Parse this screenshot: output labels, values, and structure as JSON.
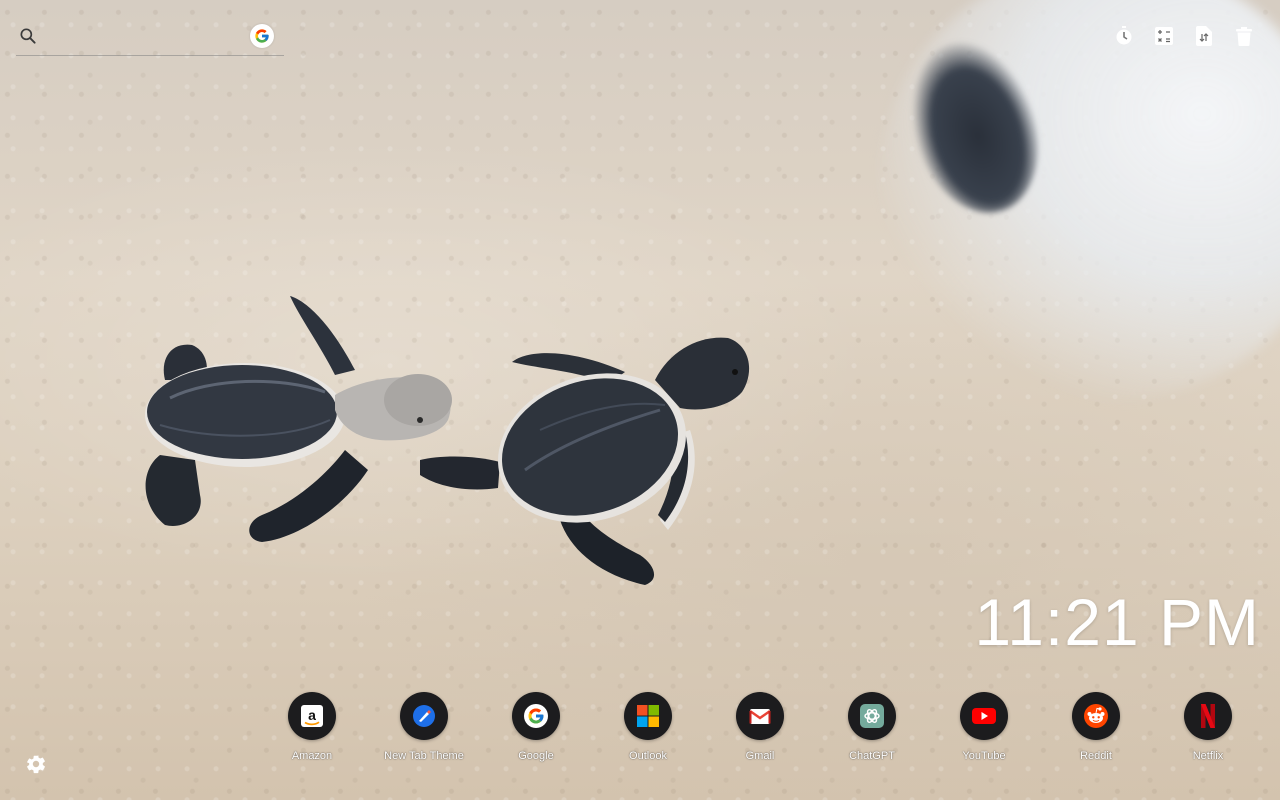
{
  "search": {
    "placeholder": "",
    "value": "",
    "icon": "search-icon",
    "engine_icon": "google-icon"
  },
  "toolbar": {
    "items": [
      {
        "icon": "timer-icon"
      },
      {
        "icon": "calculator-icon"
      },
      {
        "icon": "file-transfer-icon"
      },
      {
        "icon": "trash-icon"
      }
    ]
  },
  "clock": {
    "time": "11:21 PM",
    "color": "#ffffff"
  },
  "shortcuts": [
    {
      "label": "Amazon",
      "icon": "amazon-icon"
    },
    {
      "label": "New Tab Theme",
      "icon": "new-tab-theme-icon"
    },
    {
      "label": "Google",
      "icon": "google-icon"
    },
    {
      "label": "Outlook",
      "icon": "microsoft-icon"
    },
    {
      "label": "Gmail",
      "icon": "gmail-icon"
    },
    {
      "label": "ChatGPT",
      "icon": "chatgpt-icon"
    },
    {
      "label": "YouTube",
      "icon": "youtube-icon"
    },
    {
      "label": "Reddit",
      "icon": "reddit-icon"
    },
    {
      "label": "Netflix",
      "icon": "netflix-icon"
    }
  ],
  "settings": {
    "icon": "gear-icon"
  },
  "background": {
    "subject": "baby sea turtles on sand",
    "accent": "#1c1c1e"
  }
}
